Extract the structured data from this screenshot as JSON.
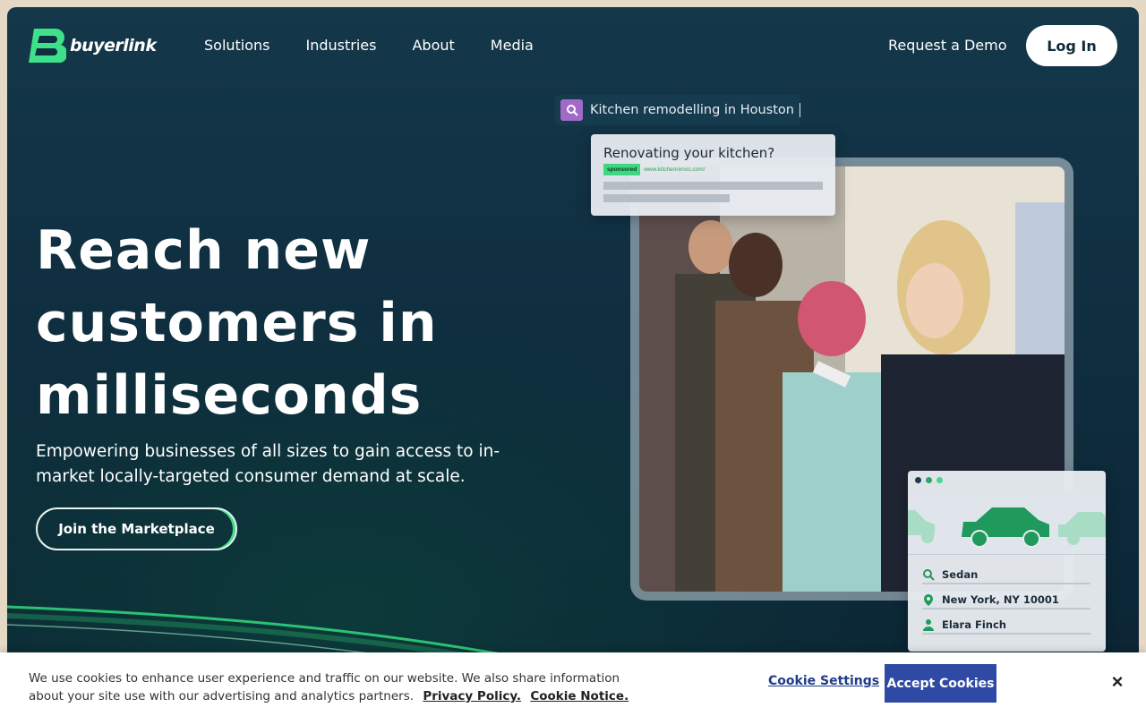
{
  "brand": {
    "name": "buyerlink"
  },
  "nav": {
    "items": [
      {
        "label": "Solutions"
      },
      {
        "label": "Industries"
      },
      {
        "label": "About"
      },
      {
        "label": "Media"
      }
    ],
    "request_demo": "Request a Demo",
    "login": "Log In"
  },
  "hero": {
    "headline_lines": [
      "Reach new",
      "customers in",
      "milliseconds"
    ],
    "subtext": "Empowering businesses of all sizes to gain access to in-market locally-targeted consumer demand at scale.",
    "cta": "Join the Marketplace"
  },
  "search_chip": {
    "query": "Kitchen remodelling in Houston",
    "icon": "search-icon"
  },
  "ad_card": {
    "title": "Renovating your kitchen?",
    "badge": "sponsored",
    "url": "www.kitchenrenos.com/"
  },
  "car_card": {
    "window_dots": [
      "#1f3b55",
      "#2fa36a",
      "#46d98a"
    ],
    "fields": [
      {
        "icon": "search-icon",
        "value": "Sedan"
      },
      {
        "icon": "location-pin-icon",
        "value": "New York, NY 10001"
      },
      {
        "icon": "person-icon",
        "value": "Elara Finch"
      }
    ]
  },
  "cookie_banner": {
    "text": "We use cookies to enhance user experience and traffic on our website. We also share information about your site use with our advertising and analytics partners.",
    "privacy_link": "Privacy Policy.",
    "cookie_notice_link": "Cookie Notice.",
    "settings_label": "Cookie Settings",
    "accept_label": "Accept Cookies",
    "close_icon": "close-icon"
  },
  "colors": {
    "accent": "#3ed67f",
    "bg_dark": "#0f2e40",
    "button_blue": "#2e4aa4"
  }
}
